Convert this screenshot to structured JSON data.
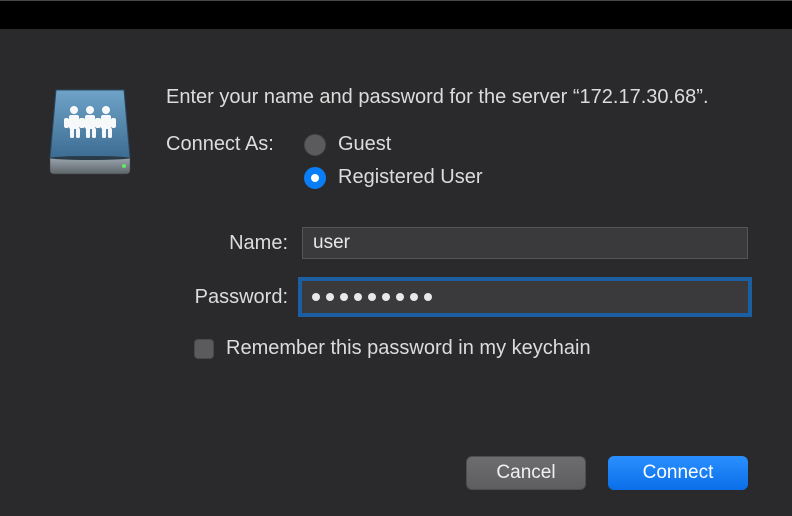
{
  "prompt": "Enter your name and password for the server “172.17.30.68”.",
  "connect_as_label": "Connect As:",
  "radio": {
    "guest_label": "Guest",
    "registered_label": "Registered User",
    "selected": "registered"
  },
  "name_field": {
    "label": "Name:",
    "value": "user"
  },
  "password_field": {
    "label": "Password:",
    "value": "•••••••••"
  },
  "remember_checkbox": {
    "label": "Remember this password in my keychain",
    "checked": false
  },
  "buttons": {
    "cancel": "Cancel",
    "connect": "Connect"
  },
  "server_ip": "172.17.30.68",
  "colors": {
    "dialog_bg": "#2a2a2c",
    "accent": "#0a7ef6",
    "button_primary": "#2a8fff",
    "button_secondary": "#6d6d6f",
    "text": "#dcdcdc",
    "input_bg": "#3a3a3c"
  }
}
